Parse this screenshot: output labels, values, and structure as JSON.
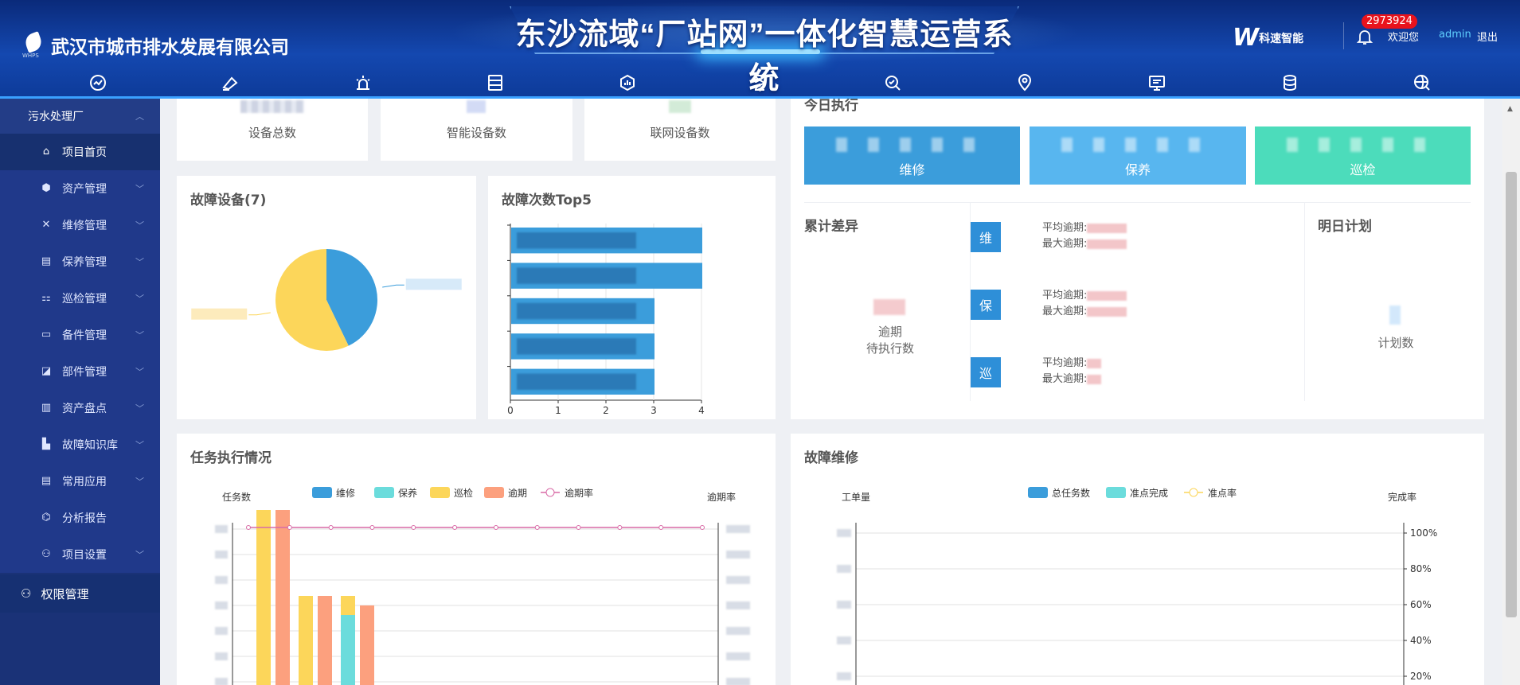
{
  "header": {
    "company_name": "武汉市城市排水发展有限公司",
    "system_title": "东沙流域“厂站网”一体化智慧运营系统",
    "brand_text": "科速智能",
    "notification_count": "2973924",
    "welcome": "欢迎您",
    "username": "admin",
    "logout": "退出",
    "nav_icons": [
      "dashboard-icon",
      "monitor-icon",
      "alarm-icon",
      "server-icon",
      "analytics-icon",
      "hourglass-icon",
      "settings-search-icon",
      "map-pin-icon",
      "screen-icon",
      "database-icon",
      "global-search-icon"
    ]
  },
  "sidebar": {
    "group_label": "污水处理厂",
    "items": [
      {
        "label": "项目首页",
        "icon": "home-icon",
        "active": true,
        "expandable": false
      },
      {
        "label": "资产管理",
        "icon": "cube-icon",
        "expandable": true
      },
      {
        "label": "维修管理",
        "icon": "tools-icon",
        "expandable": true
      },
      {
        "label": "保养管理",
        "icon": "clipboard-icon",
        "expandable": true
      },
      {
        "label": "巡检管理",
        "icon": "patrol-icon",
        "expandable": true
      },
      {
        "label": "备件管理",
        "icon": "box-icon",
        "expandable": true
      },
      {
        "label": "部件管理",
        "icon": "component-icon",
        "expandable": true
      },
      {
        "label": "资产盘点",
        "icon": "inventory-icon",
        "expandable": true
      },
      {
        "label": "故障知识库",
        "icon": "library-icon",
        "expandable": true
      },
      {
        "label": "常用应用",
        "icon": "app-icon",
        "expandable": true
      },
      {
        "label": "分析报告",
        "icon": "report-icon",
        "expandable": false
      },
      {
        "label": "项目设置",
        "icon": "user-settings-icon",
        "expandable": true
      }
    ],
    "root_item": {
      "label": "权限管理",
      "icon": "permission-icon"
    }
  },
  "stats": [
    {
      "label": "设备总数"
    },
    {
      "label": "智能设备数"
    },
    {
      "label": "联网设备数"
    }
  ],
  "today_exec": {
    "title": "今日执行",
    "boxes": [
      {
        "label": "维修",
        "color": "#3b9ddb"
      },
      {
        "label": "保养",
        "color": "#58b6ef"
      },
      {
        "label": "巡检",
        "color": "#4cdcbb"
      }
    ]
  },
  "accumulated": {
    "title": "累计差异",
    "overdue_label_1": "逾期",
    "overdue_label_2": "待执行数",
    "rows": [
      {
        "tag": "维",
        "avg_label": "平均逾期:",
        "max_label": "最大逾期:"
      },
      {
        "tag": "保",
        "avg_label": "平均逾期:",
        "max_label": "最大逾期:"
      },
      {
        "tag": "巡",
        "avg_label": "平均逾期:",
        "max_label": "最大逾期:"
      }
    ]
  },
  "tomorrow": {
    "title": "明日计划",
    "count_label": "计划数"
  },
  "fault_devices": {
    "title": "故障设备(7)"
  },
  "fault_top5": {
    "title": "故障次数Top5"
  },
  "task_exec": {
    "title": "任务执行情况"
  },
  "fault_repair": {
    "title": "故障维修"
  },
  "chart_data": [
    {
      "type": "pie",
      "title": "故障设备(7)",
      "slices": [
        {
          "name": "",
          "value": 3,
          "color": "#3b9ddb"
        },
        {
          "name": "",
          "value": 4,
          "color": "#fcd65a"
        }
      ]
    },
    {
      "type": "bar",
      "orientation": "horizontal",
      "title": "故障次数Top5",
      "categories": [
        "",
        "",
        "",
        "",
        ""
      ],
      "values": [
        4,
        4,
        3,
        3,
        3
      ],
      "xlim": [
        0,
        4
      ],
      "xticks": [
        "0",
        "1",
        "2",
        "3",
        "4"
      ],
      "color": "#3b9ddb"
    },
    {
      "type": "bar",
      "title": "任务执行情况",
      "ylabel": "任务数",
      "y2label": "逾期率",
      "legend": [
        "维修",
        "保养",
        "巡检",
        "逾期",
        "逾期率"
      ],
      "legend_colors": [
        "#3b9ddb",
        "#6bdcdc",
        "#fcd65a",
        "#fca07e",
        "#d86aa6"
      ],
      "groups": [
        {
          "巡检": 0.95,
          "逾期": 0.95,
          "保养": 0
        },
        {
          "巡检": 0.5,
          "逾期": 0.5,
          "保养": 0
        },
        {
          "巡检": 0.5,
          "逾期": 0.45,
          "保养": 0.4
        }
      ],
      "rate_line": 1.0,
      "legend_position": "top"
    },
    {
      "type": "line",
      "title": "故障维修",
      "ylabel": "工单量",
      "y2label": "完成率",
      "legend": [
        "总任务数",
        "准点完成",
        "准点率"
      ],
      "legend_colors": [
        "#3b9ddb",
        "#6bdcdc",
        "#fcd65a"
      ],
      "y2ticks": [
        "100%",
        "80%",
        "60%",
        "40%",
        "20%"
      ],
      "legend_position": "top"
    }
  ]
}
